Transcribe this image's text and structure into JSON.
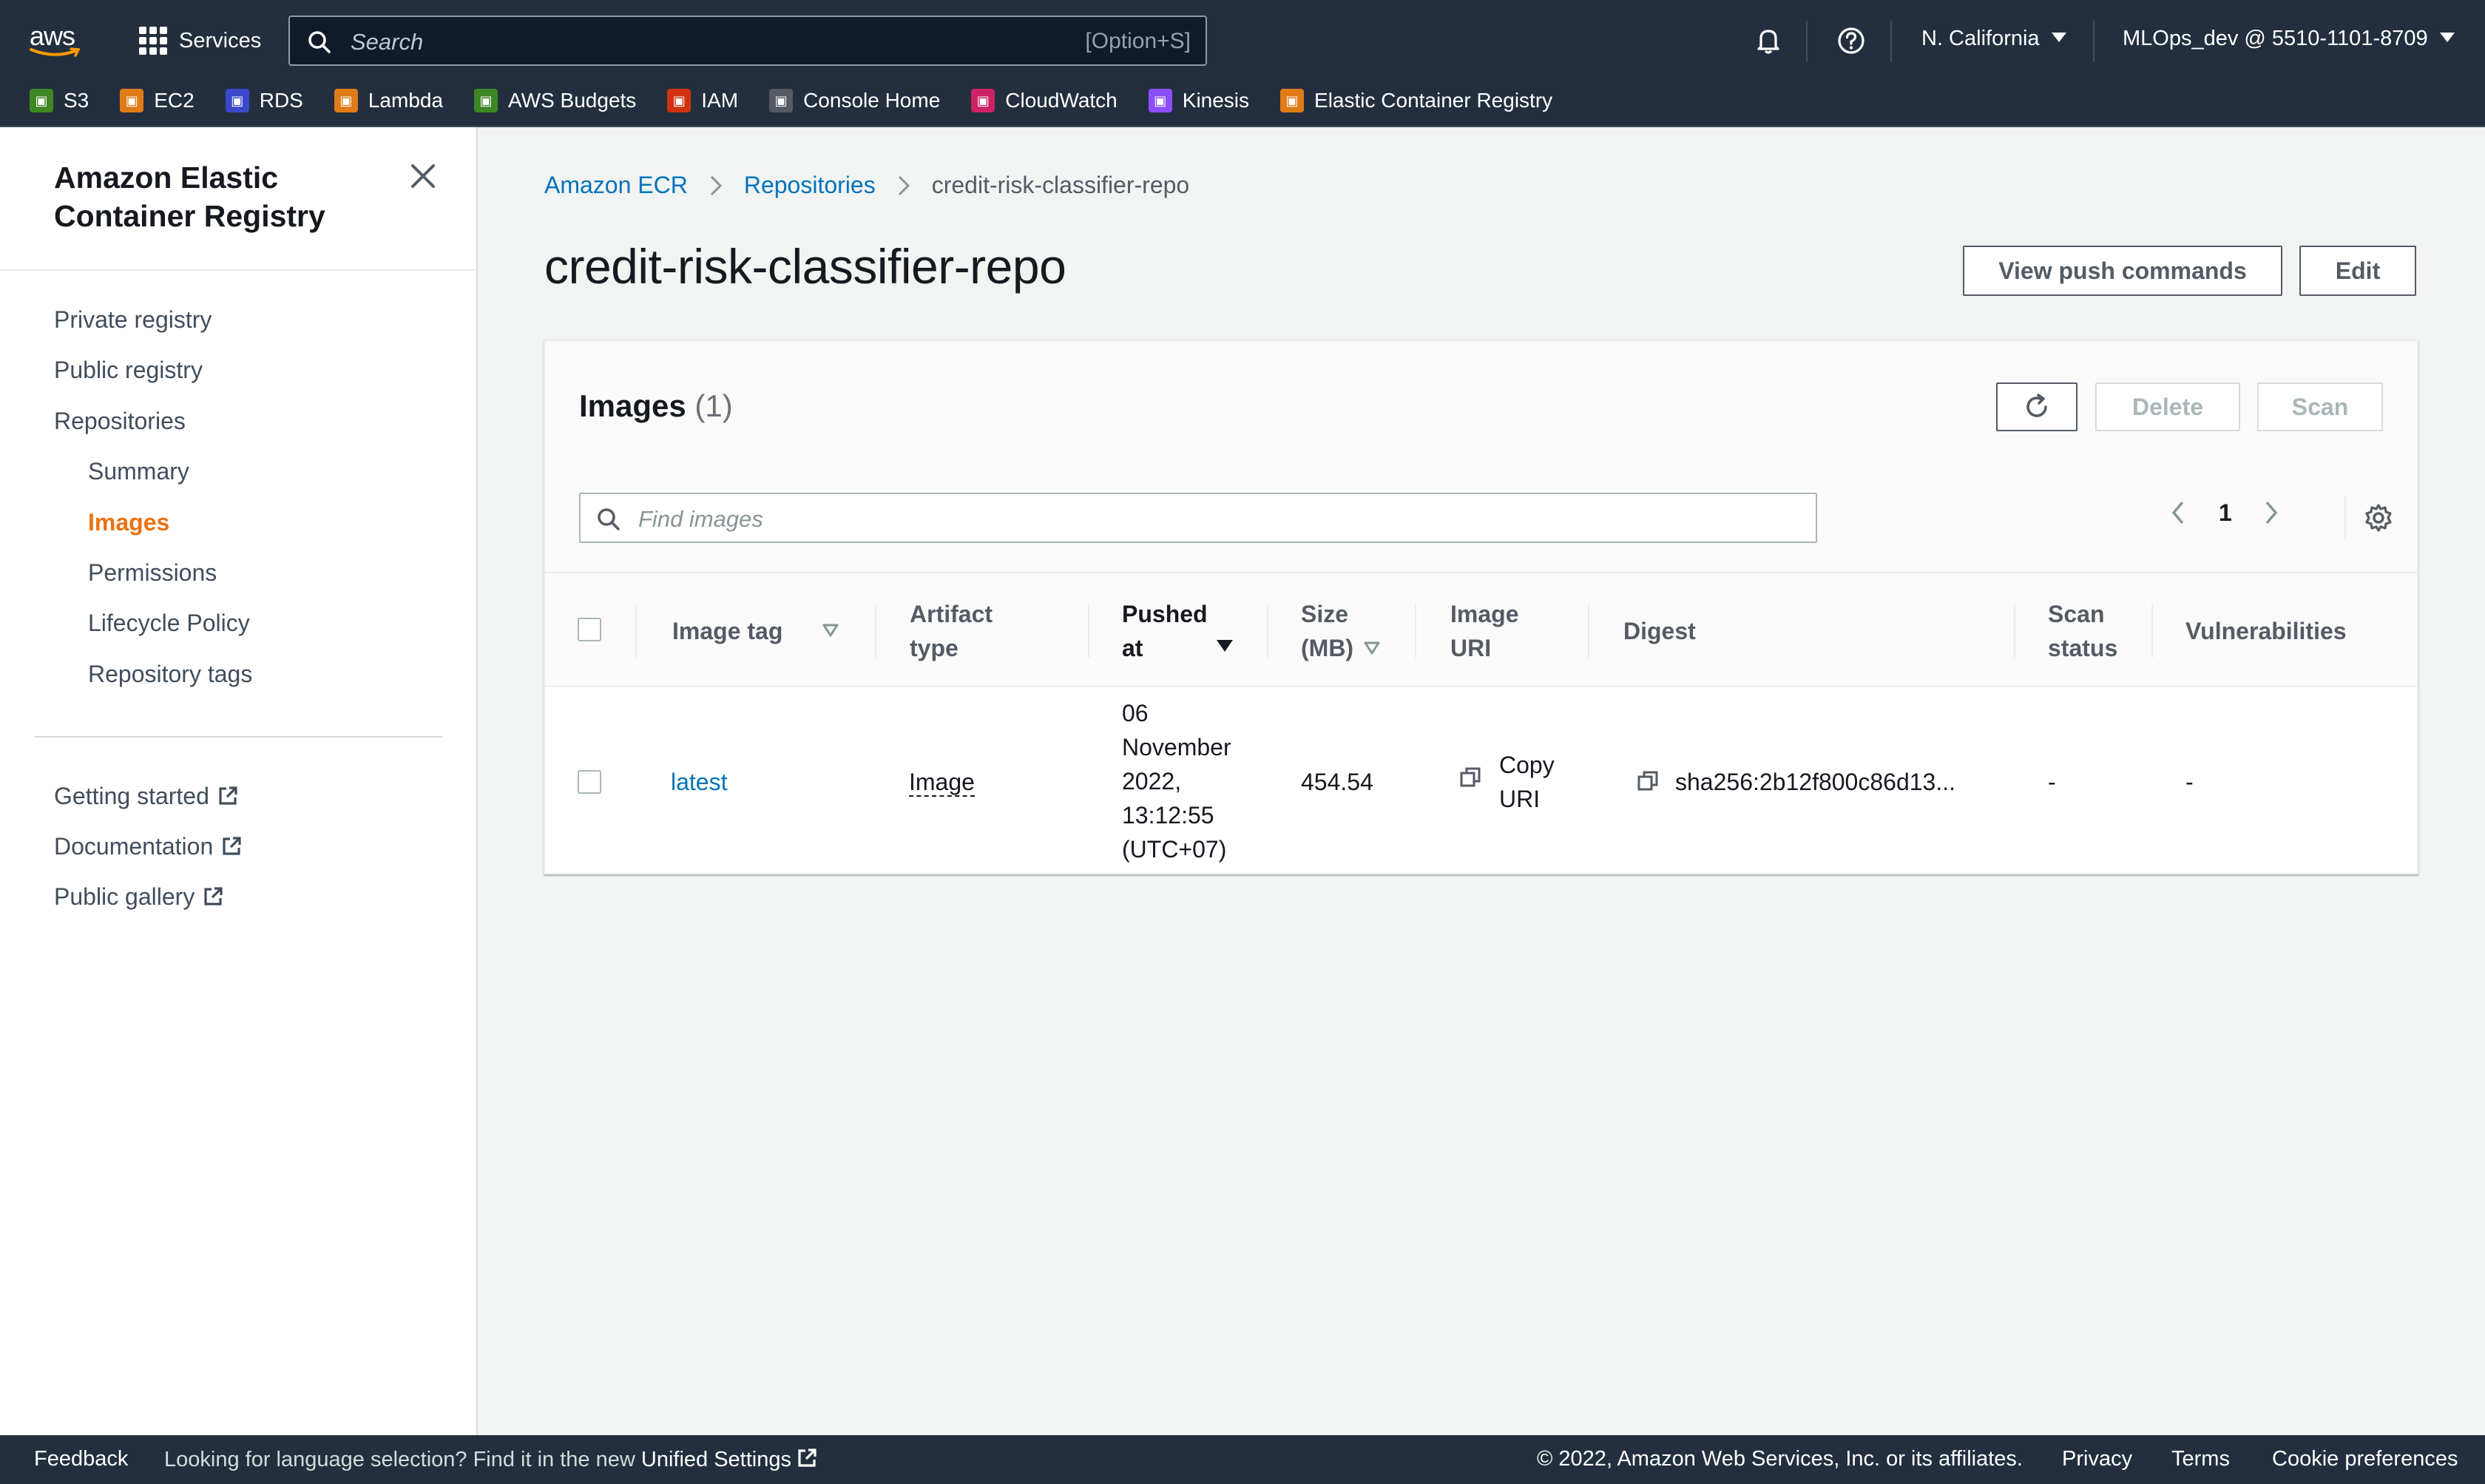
{
  "topnav": {
    "brand": "aws",
    "services_label": "Services",
    "search_placeholder": "Search",
    "search_shortcut": "[Option+S]",
    "region": "N. California",
    "account": "MLOps_dev @ 5510-1101-8709",
    "icons": [
      "grid-icon",
      "search-icon",
      "bell-icon",
      "help-icon",
      "caret-down-icon"
    ]
  },
  "favorites": [
    {
      "label": "S3",
      "color": "#3f8624"
    },
    {
      "label": "EC2",
      "color": "#e07b18"
    },
    {
      "label": "RDS",
      "color": "#3b48cc"
    },
    {
      "label": "Lambda",
      "color": "#e07b18"
    },
    {
      "label": "AWS Budgets",
      "color": "#3f8624"
    },
    {
      "label": "IAM",
      "color": "#d13212"
    },
    {
      "label": "Console Home",
      "color": "#545b64"
    },
    {
      "label": "CloudWatch",
      "color": "#cc2264"
    },
    {
      "label": "Kinesis",
      "color": "#8c4fff"
    },
    {
      "label": "Elastic Container Registry",
      "color": "#e07b18"
    }
  ],
  "sidenav": {
    "title": "Amazon Elastic Container Registry",
    "items": [
      {
        "label": "Private registry"
      },
      {
        "label": "Public registry"
      },
      {
        "label": "Repositories"
      },
      {
        "label": "Summary"
      },
      {
        "label": "Images",
        "active": true
      },
      {
        "label": "Permissions"
      },
      {
        "label": "Lifecycle Policy"
      },
      {
        "label": "Repository tags"
      }
    ],
    "external": [
      {
        "label": "Getting started"
      },
      {
        "label": "Documentation"
      },
      {
        "label": "Public gallery"
      }
    ]
  },
  "breadcrumb": {
    "items": [
      "Amazon ECR",
      "Repositories"
    ],
    "current": "credit-risk-classifier-repo"
  },
  "page": {
    "title": "credit-risk-classifier-repo",
    "view_push_label": "View push commands",
    "edit_label": "Edit"
  },
  "images_panel": {
    "title": "Images",
    "count": "(1)",
    "delete_label": "Delete",
    "scan_label": "Scan",
    "search_placeholder": "Find images",
    "page_number": "1",
    "columns": {
      "image_tag": "Image tag",
      "artifact_type_1": "Artifact",
      "artifact_type_2": "type",
      "pushed_at_1": "Pushed",
      "pushed_at_2": "at",
      "size_1": "Size",
      "size_2": "(MB)",
      "uri_1": "Image",
      "uri_2": "URI",
      "digest": "Digest",
      "scan_1": "Scan",
      "scan_2": "status",
      "vulnerabilities": "Vulnerabilities"
    },
    "rows": [
      {
        "image_tag": "latest",
        "artifact_type": "Image",
        "pushed_at_lines": [
          "06",
          "November",
          "2022,",
          "13:12:55",
          "(UTC+07)"
        ],
        "size": "454.54",
        "copy_uri_1": "Copy",
        "copy_uri_2": "URI",
        "digest": "sha256:2b12f800c86d13...",
        "scan_status": "-",
        "vulnerabilities": "-"
      }
    ]
  },
  "footer": {
    "feedback": "Feedback",
    "language_text": "Looking for language selection? Find it in the new",
    "unified_settings": "Unified Settings",
    "copyright": "© 2022, Amazon Web Services, Inc. or its affiliates.",
    "privacy": "Privacy",
    "terms": "Terms",
    "cookie": "Cookie preferences"
  }
}
